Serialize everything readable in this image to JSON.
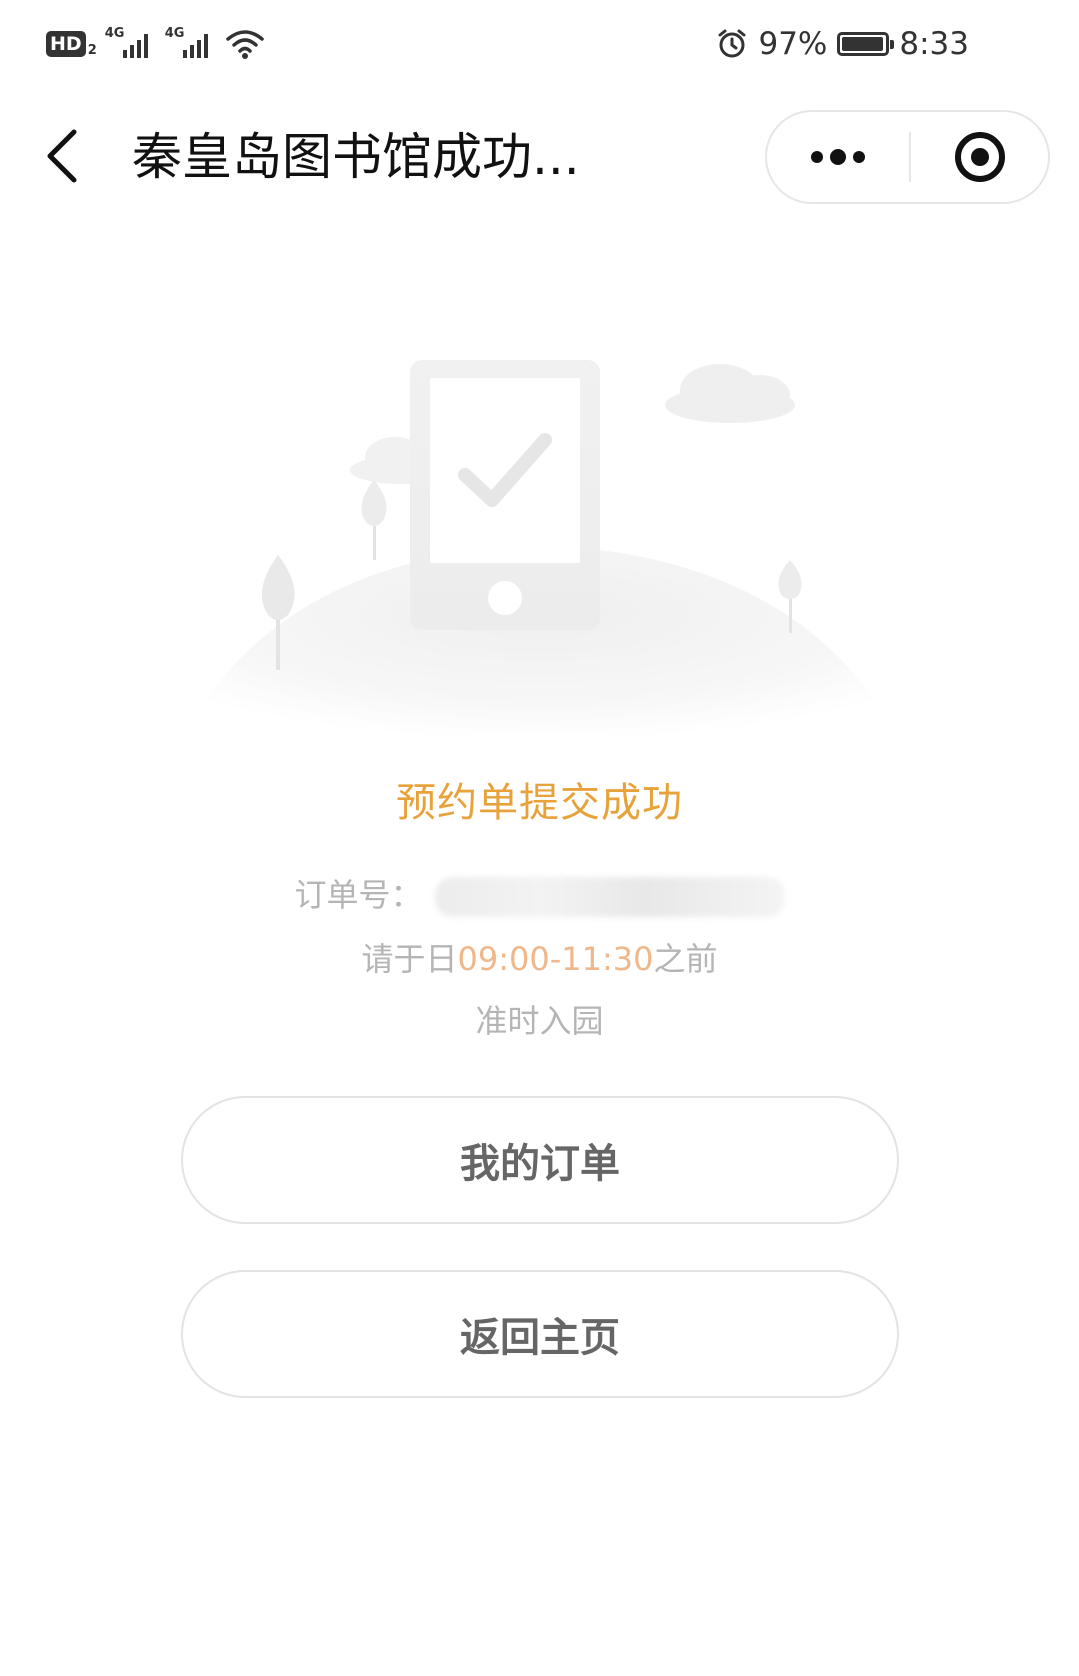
{
  "status_bar": {
    "hd_label": "HD",
    "hd_sub": "2",
    "network_1": "4G",
    "network_2": "4G",
    "alarm_icon": "alarm-icon",
    "battery_percent": "97%",
    "battery_level": 0.97,
    "time": "8:33"
  },
  "nav": {
    "back_icon": "chevron-left-icon",
    "title": "秦皇岛图书馆成功...",
    "more_icon": "more-dots-icon",
    "close_icon": "target-circle-icon"
  },
  "illustration": {
    "icon": "phone-checkmark-illustration"
  },
  "result": {
    "title": "预约单提交成功",
    "order_label": "订单号：",
    "time_prefix": "请于日",
    "time_range": "09:00-11:30",
    "time_suffix": "之前",
    "enter_text": "准时入园"
  },
  "buttons": {
    "my_orders": "我的订单",
    "back_home": "返回主页"
  },
  "colors": {
    "accent": "#e8a23a",
    "time_highlight": "#efb78a",
    "muted_text": "#b5b5b5",
    "button_text": "#666666"
  }
}
